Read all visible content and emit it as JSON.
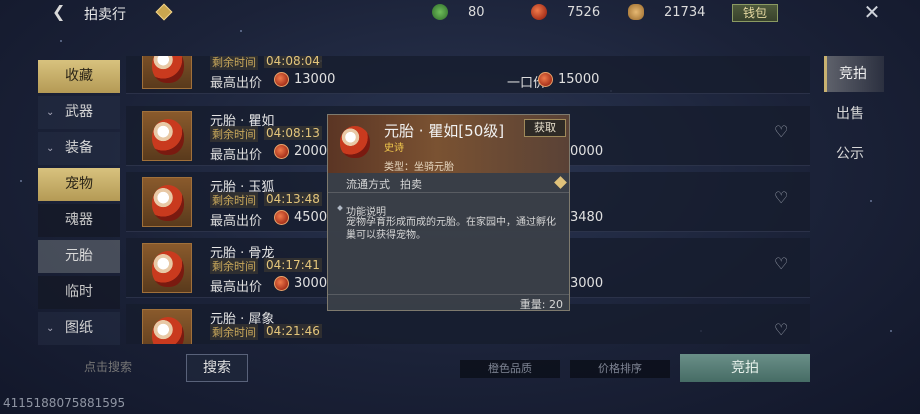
{
  "header": {
    "title": "拍卖行",
    "currencies": [
      {
        "icon": "jade-coin-icon",
        "value": "80",
        "color": "#3e8a3a"
      },
      {
        "icon": "red-coin-icon",
        "value": "7526",
        "color": "#c9461e"
      },
      {
        "icon": "gold-ingot-icon",
        "value": "21734",
        "color": "#c08a3a"
      }
    ],
    "wallet_label": "钱包"
  },
  "sidebar": {
    "items": [
      {
        "label": "收藏",
        "kind": "active"
      },
      {
        "label": "武器",
        "kind": "cat"
      },
      {
        "label": "装备",
        "kind": "cat"
      },
      {
        "label": "宠物",
        "kind": "active"
      },
      {
        "label": "魂器",
        "kind": "sub"
      },
      {
        "label": "元胎",
        "kind": "sub-selected"
      },
      {
        "label": "临时",
        "kind": "sub"
      },
      {
        "label": "图纸",
        "kind": "cat"
      }
    ]
  },
  "listing": {
    "remaining_label": "剩余时间",
    "bid_label": "最高出价",
    "buyout_label": "一口价",
    "rows": [
      {
        "name": "",
        "time": "04:08:04",
        "bid": "13000",
        "buyout": "15000"
      },
      {
        "name": "元胎 · 瞿如",
        "time": "04:08:13",
        "bid": "2000",
        "buyout": "0000"
      },
      {
        "name": "元胎 · 玉狐",
        "time": "04:13:48",
        "bid": "4500",
        "buyout": "3480"
      },
      {
        "name": "元胎 · 骨龙",
        "time": "04:17:41",
        "bid": "3000",
        "buyout": "3000"
      },
      {
        "name": "元胎 · 犀象",
        "time": "04:21:46",
        "bid": "",
        "buyout": ""
      }
    ]
  },
  "right_tabs": [
    "竞拍",
    "出售",
    "公示"
  ],
  "bottom": {
    "search_placeholder": "点击搜索",
    "search_label": "搜索",
    "quality_label": "橙色品质",
    "sort_label": "价格排序",
    "bid_button_label": "竞拍"
  },
  "uid": "4115188075881595",
  "tooltip": {
    "name": "元胎 · 瞿如[50级]",
    "rarity": "史诗",
    "type": "类型：坐骑元胎",
    "get_label": "获取",
    "flow_label": "流通方式",
    "flow_value": "拍卖",
    "desc_title": "功能说明",
    "desc": "宠物孕育形成而成的元胎。在家园中，通过孵化巢可以获得宠物。",
    "weight": "重量: 20"
  }
}
